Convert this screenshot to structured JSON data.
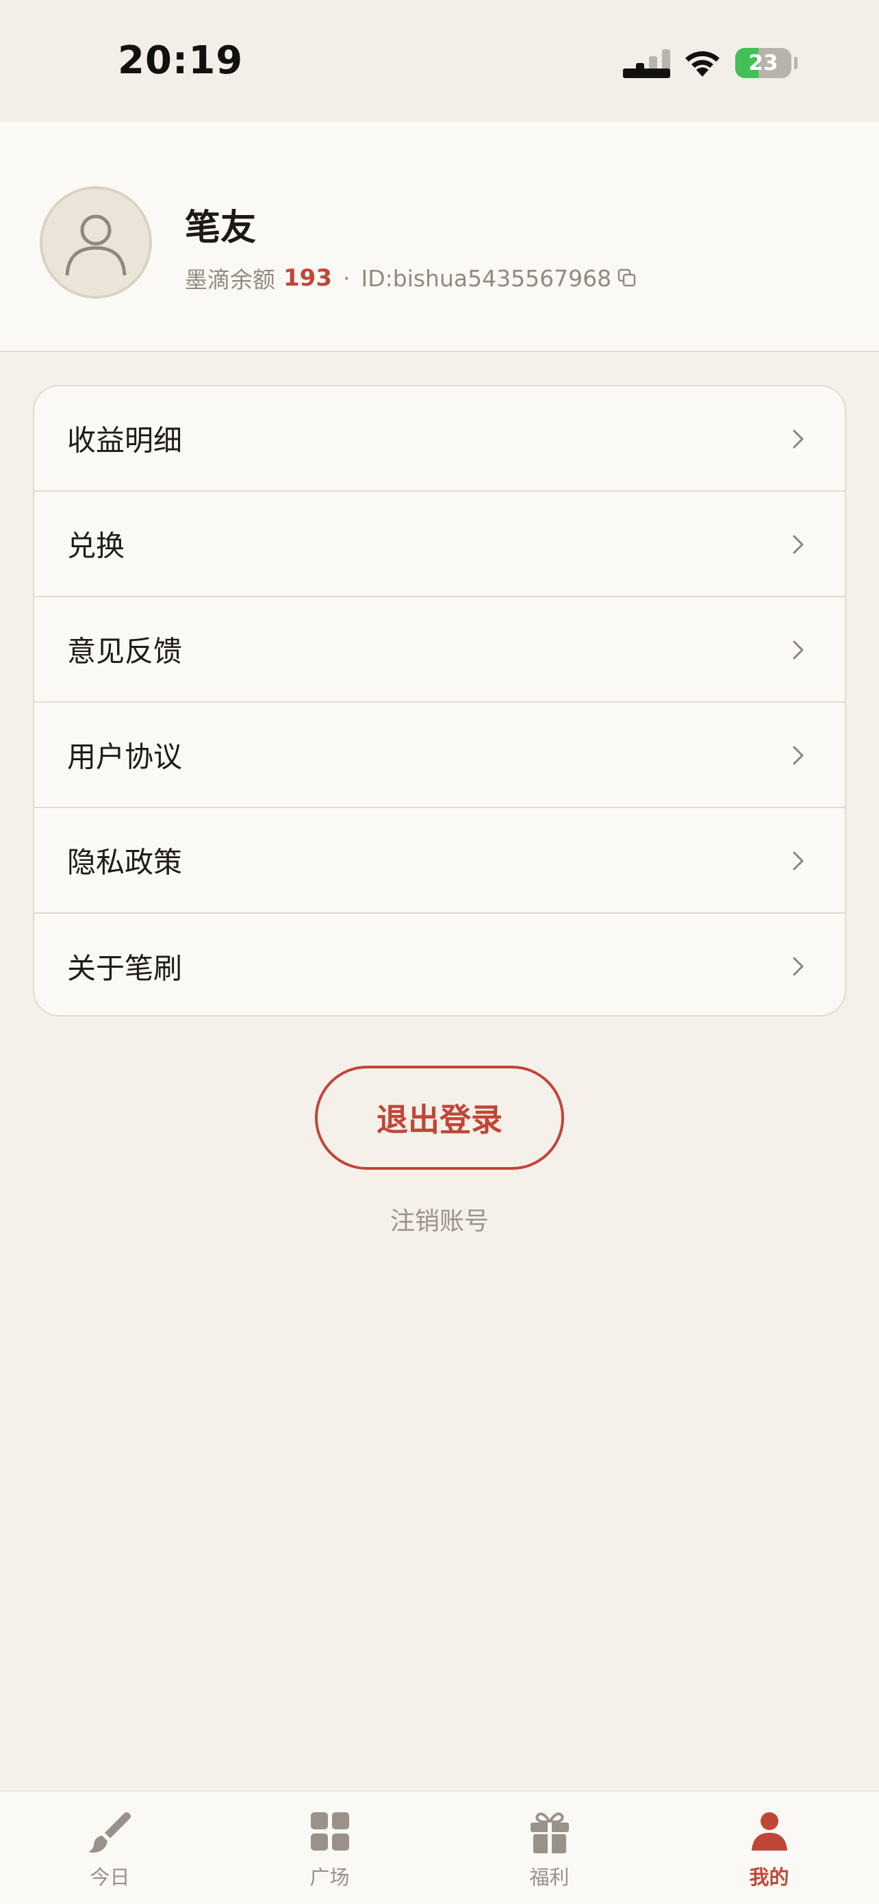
{
  "status_bar": {
    "time": "20:19",
    "battery_level": "23"
  },
  "profile": {
    "nickname": "笔友",
    "ink_label": "墨滴余额",
    "ink_balance": "193",
    "separator": "·",
    "user_id": "ID:bishua5435567968"
  },
  "menu": {
    "items": [
      {
        "label": "收益明细"
      },
      {
        "label": "兑换"
      },
      {
        "label": "意见反馈"
      },
      {
        "label": "用户协议"
      },
      {
        "label": "隐私政策"
      },
      {
        "label": "关于笔刷"
      }
    ]
  },
  "actions": {
    "logout_label": "退出登录",
    "delete_account_label": "注销账号"
  },
  "tab_bar": {
    "tabs": [
      {
        "label": "今日",
        "icon": "brush-icon",
        "active": false
      },
      {
        "label": "广场",
        "icon": "grid-icon",
        "active": false
      },
      {
        "label": "福利",
        "icon": "gift-icon",
        "active": false
      },
      {
        "label": "我的",
        "icon": "person-icon",
        "active": true
      }
    ]
  },
  "colors": {
    "accent": "#c04637",
    "background": "#f5f0ea",
    "card": "#fbf9f5",
    "muted_text": "#928a80",
    "battery_green": "#40c055"
  }
}
